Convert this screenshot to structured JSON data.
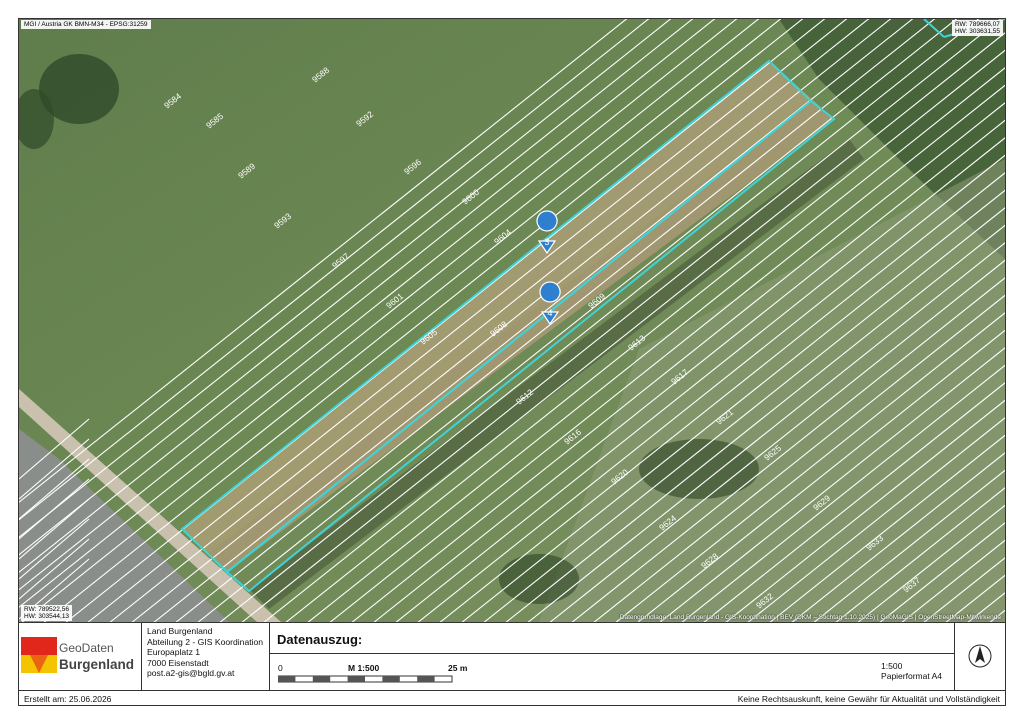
{
  "map": {
    "crs_label": "MGI / Austria GK BMN-M34 - EPSG:31259",
    "top_right_coords": [
      "RW: 789666,07",
      "HW: 303631,55"
    ],
    "bottom_left_coords": [
      "RW: 789522,56",
      "HW: 303544,13"
    ],
    "attribution": "Datengrundlage: Land Burgenland - GIS-Koordination | BEV (DKM – Stichtag 1.10.2025) | GeoMaGIS | OpenStreetMap-Mitwirkende",
    "markers": [
      "3",
      "4"
    ],
    "parcel_numbers": [
      "9584",
      "9585",
      "9588",
      "9589",
      "9592",
      "9593",
      "9596",
      "9597",
      "9600",
      "9601",
      "9604",
      "9605",
      "9608",
      "9609",
      "9612",
      "9613",
      "9616",
      "9617",
      "9620",
      "9621",
      "9624",
      "9625",
      "9628",
      "9629",
      "9632",
      "9633",
      "9637"
    ],
    "colors": {
      "parcel_lines": "#ffffff",
      "highlight": "#3fd3d8",
      "marker": "#2f7fd1"
    }
  },
  "footer": {
    "logo_text_top": "GeoDaten",
    "logo_text_bottom": "Burgenland",
    "address": [
      "Land Burgenland",
      "Abteilung 2 - GIS Koordination",
      "Europaplatz 1",
      "7000 Eisenstadt",
      "post.a2-gis@bgld.gv.at"
    ],
    "title": "Datenauszug:",
    "scale_start": "0",
    "scale_label": "M 1:500",
    "scale_end": "25 m",
    "scale_ratio": "1:500",
    "paper_format": "Papierformat A4",
    "north_icon": "north-arrow-icon"
  },
  "status": {
    "created": "Erstellt am: 25.06.2026",
    "disclaimer": "Keine Rechtsauskunft, keine Gewähr für Aktualität und Vollständigkeit"
  }
}
